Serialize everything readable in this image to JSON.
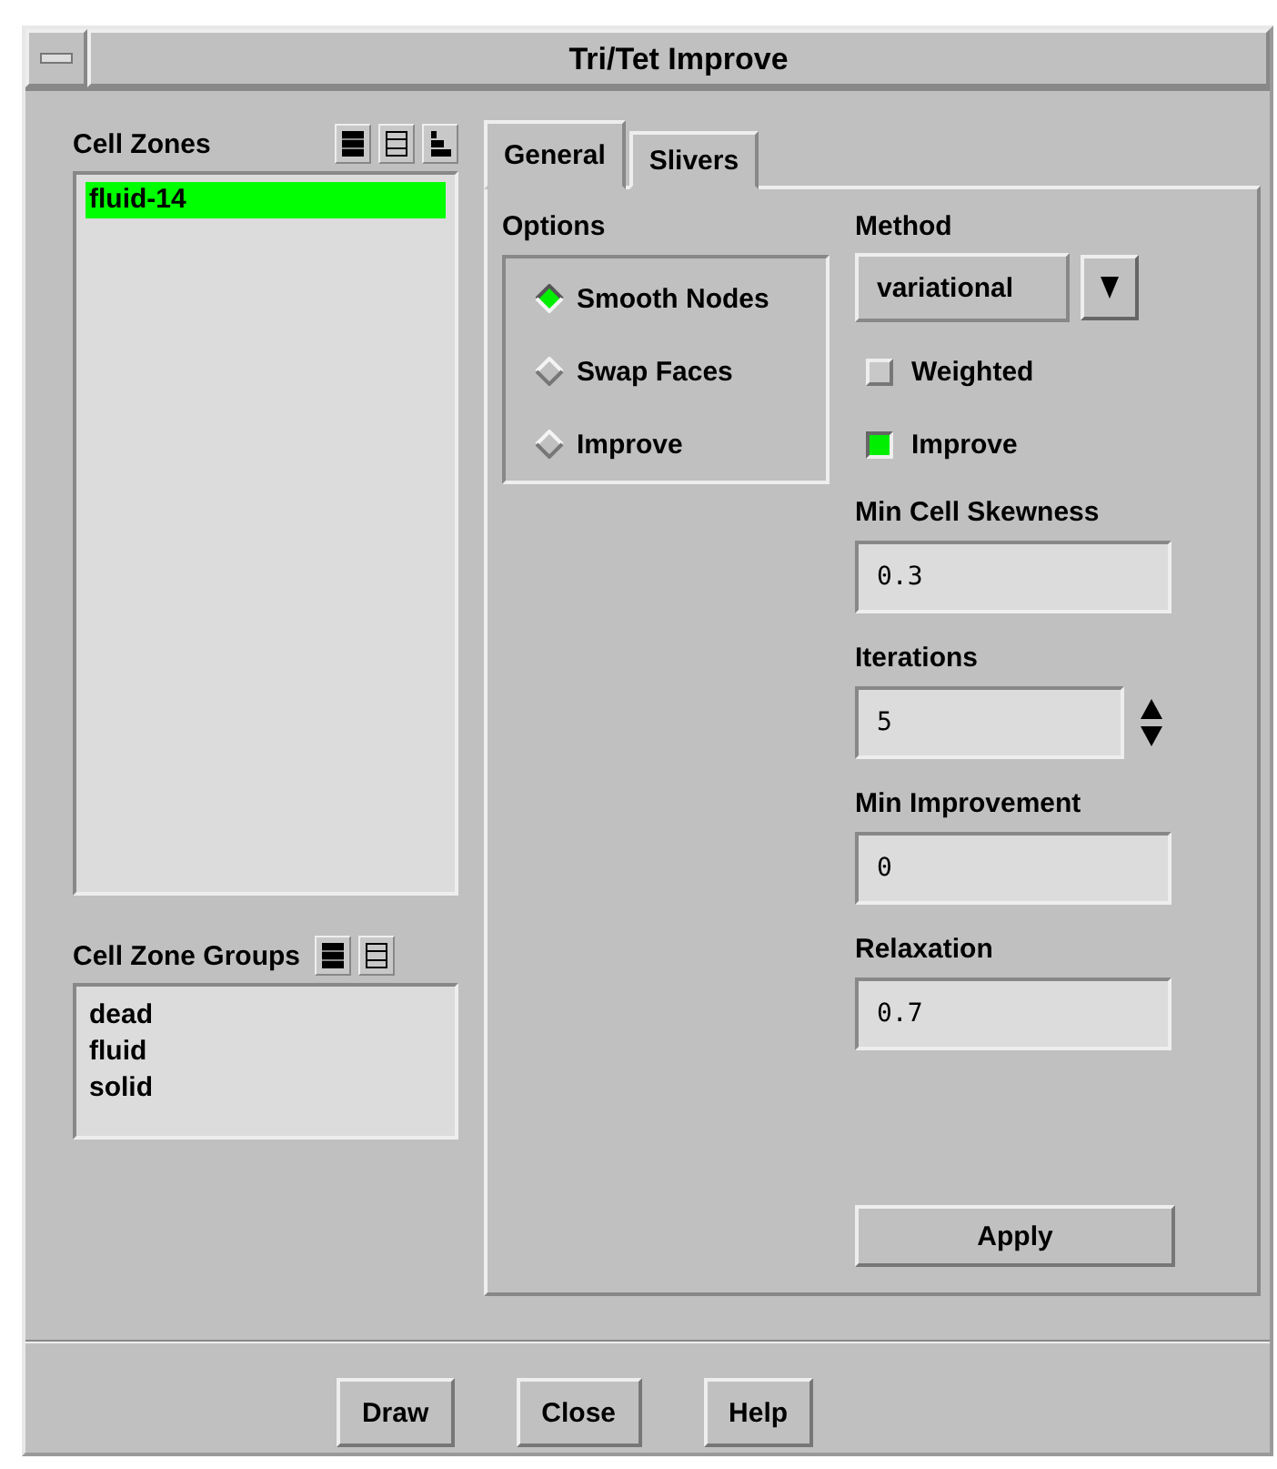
{
  "window": {
    "title": "Tri/Tet Improve"
  },
  "cell_zones": {
    "label": "Cell Zones",
    "items": [
      {
        "label": "fluid-14",
        "selected": true
      }
    ]
  },
  "cell_zone_groups": {
    "label": "Cell Zone Groups",
    "items": [
      {
        "label": "dead",
        "selected": false
      },
      {
        "label": "fluid",
        "selected": false
      },
      {
        "label": "solid",
        "selected": false
      }
    ]
  },
  "tabs": [
    {
      "label": "General",
      "selected": true
    },
    {
      "label": "Slivers",
      "selected": false
    }
  ],
  "options": {
    "label": "Options",
    "radios": [
      {
        "label": "Smooth Nodes",
        "selected": true
      },
      {
        "label": "Swap Faces",
        "selected": false
      },
      {
        "label": "Improve",
        "selected": false
      }
    ]
  },
  "method": {
    "label": "Method",
    "value": "variational"
  },
  "checkboxes": [
    {
      "label": "Weighted",
      "checked": false
    },
    {
      "label": "Improve",
      "checked": true
    }
  ],
  "fields": [
    {
      "label": "Min Cell Skewness",
      "value": "0.3",
      "kind": "text"
    },
    {
      "label": "Iterations",
      "value": "5",
      "kind": "spinner"
    },
    {
      "label": "Min Improvement",
      "value": "0",
      "kind": "text"
    },
    {
      "label": "Relaxation",
      "value": "0.7",
      "kind": "text"
    }
  ],
  "apply": "Apply",
  "buttons": [
    "Draw",
    "Close",
    "Help"
  ]
}
